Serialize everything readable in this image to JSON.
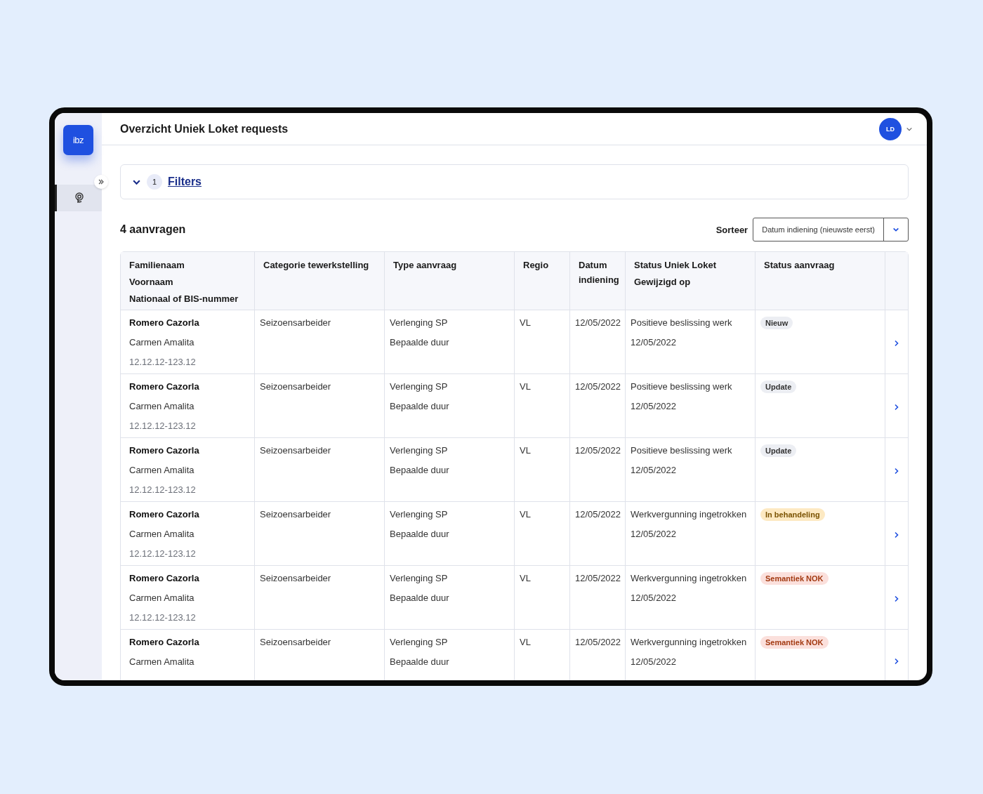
{
  "app": {
    "logo": "ibz"
  },
  "sidebar": {
    "items": [
      {
        "selected": true
      }
    ]
  },
  "header": {
    "title": "Overzicht Uniek Loket requests",
    "user_initials": "LD"
  },
  "filters": {
    "expanded": false,
    "count": "1",
    "label": "Filters"
  },
  "results": {
    "count_label": "4 aanvragen",
    "sort_label": "Sorteer",
    "sort_value": "Datum indiening (nieuwste eerst)"
  },
  "table": {
    "columns": [
      {
        "lines": [
          "Familienaam",
          "Voornaam",
          "Nationaal of BIS-nummer"
        ]
      },
      {
        "lines": [
          "Categorie tewerkstelling"
        ]
      },
      {
        "lines": [
          "Type aanvraag"
        ]
      },
      {
        "lines": [
          "Regio"
        ]
      },
      {
        "lines": [
          "Datum indiening"
        ]
      },
      {
        "lines": [
          "Status Uniek Loket",
          "Gewijzigd op"
        ]
      },
      {
        "lines": [
          "Status aanvraag"
        ]
      }
    ],
    "rows": [
      {
        "surname": "Romero Cazorla",
        "first_name": "Carmen Amalita",
        "number": "12.12.12-123.12",
        "category": "Seizoensarbeider",
        "type": [
          "Verlenging SP",
          "Bepaalde duur"
        ],
        "region": "VL",
        "date": "12/05/2022",
        "status_loket": "Positieve beslissing werk",
        "changed_on": "12/05/2022",
        "status": {
          "label": "Nieuw",
          "kind": "neutral"
        }
      },
      {
        "surname": "Romero Cazorla",
        "first_name": "Carmen Amalita",
        "number": "12.12.12-123.12",
        "category": "Seizoensarbeider",
        "type": [
          "Verlenging SP",
          "Bepaalde duur"
        ],
        "region": "VL",
        "date": "12/05/2022",
        "status_loket": "Positieve beslissing werk",
        "changed_on": "12/05/2022",
        "status": {
          "label": "Update",
          "kind": "neutral"
        }
      },
      {
        "surname": "Romero Cazorla",
        "first_name": "Carmen Amalita",
        "number": "12.12.12-123.12",
        "category": "Seizoensarbeider",
        "type": [
          "Verlenging SP",
          "Bepaalde duur"
        ],
        "region": "VL",
        "date": "12/05/2022",
        "status_loket": "Positieve beslissing werk",
        "changed_on": "12/05/2022",
        "status": {
          "label": "Update",
          "kind": "neutral"
        }
      },
      {
        "surname": "Romero Cazorla",
        "first_name": "Carmen Amalita",
        "number": "12.12.12-123.12",
        "category": "Seizoensarbeider",
        "type": [
          "Verlenging SP",
          "Bepaalde duur"
        ],
        "region": "VL",
        "date": "12/05/2022",
        "status_loket": "Werkvergunning ingetrokken",
        "changed_on": "12/05/2022",
        "status": {
          "label": "In behandeling",
          "kind": "warning"
        }
      },
      {
        "surname": "Romero Cazorla",
        "first_name": "Carmen Amalita",
        "number": "12.12.12-123.12",
        "category": "Seizoensarbeider",
        "type": [
          "Verlenging SP",
          "Bepaalde duur"
        ],
        "region": "VL",
        "date": "12/05/2022",
        "status_loket": "Werkvergunning ingetrokken",
        "changed_on": "12/05/2022",
        "status": {
          "label": "Semantiek NOK",
          "kind": "danger"
        }
      },
      {
        "surname": "Romero Cazorla",
        "first_name": "Carmen Amalita",
        "category": "Seizoensarbeider",
        "type": [
          "Verlenging SP",
          "Bepaalde duur"
        ],
        "region": "VL",
        "date": "12/05/2022",
        "status_loket": "Werkvergunning ingetrokken",
        "changed_on": "12/05/2022",
        "status": {
          "label": "Semantiek NOK",
          "kind": "danger"
        }
      }
    ]
  }
}
